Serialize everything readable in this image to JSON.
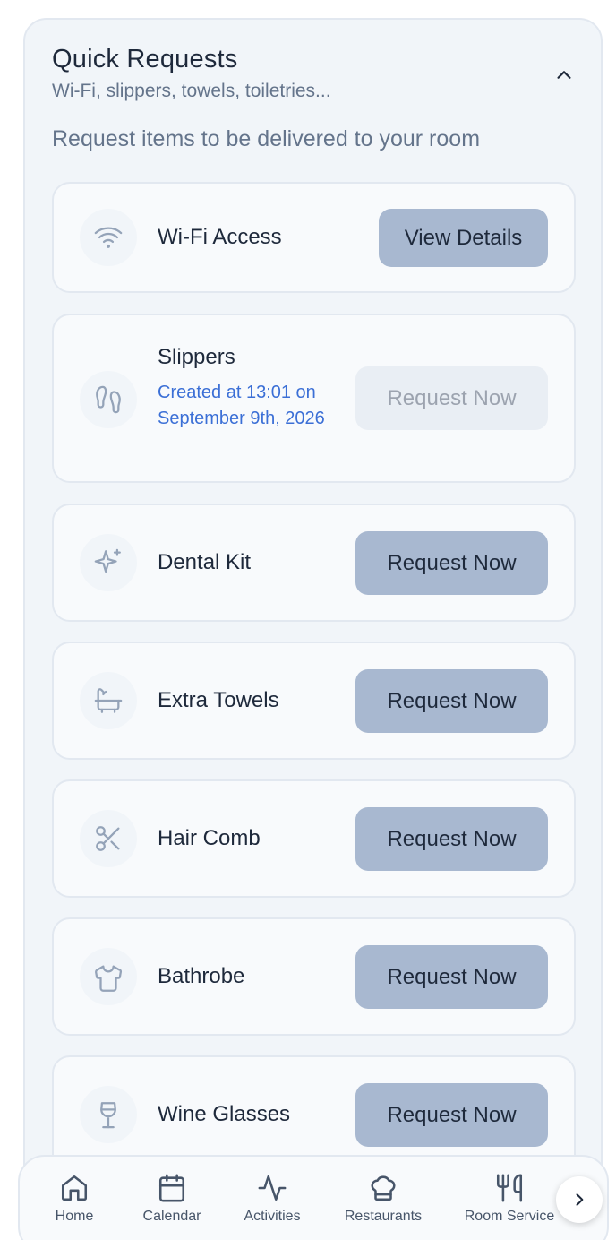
{
  "header": {
    "title": "Quick Requests",
    "subtitle": "Wi-Fi, slippers, towels, toiletries...",
    "description": "Request items to be delivered to your room",
    "collapse_icon": "chevron-up-icon"
  },
  "items": [
    {
      "name": "Wi-Fi Access",
      "icon": "wifi-icon",
      "button": "View Details",
      "button_state": "enabled"
    },
    {
      "name": "Slippers",
      "icon": "footprints-icon",
      "status": "Created at 13:01 on September 9th, 2026",
      "button": "Request Now",
      "button_state": "disabled"
    },
    {
      "name": "Dental Kit",
      "icon": "sparkles-icon",
      "button": "Request Now",
      "button_state": "enabled"
    },
    {
      "name": "Extra Towels",
      "icon": "bath-icon",
      "button": "Request Now",
      "button_state": "enabled"
    },
    {
      "name": "Hair Comb",
      "icon": "scissors-icon",
      "button": "Request Now",
      "button_state": "enabled"
    },
    {
      "name": "Bathrobe",
      "icon": "shirt-icon",
      "button": "Request Now",
      "button_state": "enabled"
    },
    {
      "name": "Wine Glasses",
      "icon": "wine-glass-icon",
      "button": "Request Now",
      "button_state": "enabled"
    }
  ],
  "nav": {
    "items": [
      {
        "label": "Home",
        "icon": "home-icon"
      },
      {
        "label": "Calendar",
        "icon": "calendar-icon"
      },
      {
        "label": "Activities",
        "icon": "activity-icon"
      },
      {
        "label": "Restaurants",
        "icon": "chef-hat-icon"
      },
      {
        "label": "Room Service",
        "icon": "utensils-icon"
      }
    ],
    "next_icon": "chevron-right-icon"
  },
  "colors": {
    "accent_button": "#a8b8d0",
    "disabled_button": "#e9eef4",
    "status_text": "#3b6fd6",
    "panel_bg": "#f1f5f9"
  }
}
